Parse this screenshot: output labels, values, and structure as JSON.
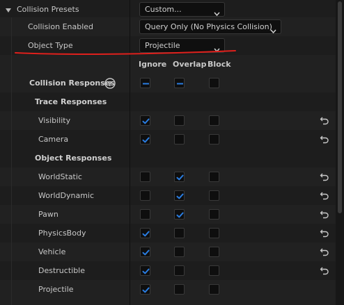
{
  "presets": {
    "label": "Collision Presets",
    "value": "Custom..."
  },
  "collision_enabled": {
    "label": "Collision Enabled",
    "value": "Query Only (No Physics Collision)"
  },
  "object_type": {
    "label": "Object Type",
    "value": "Projectile"
  },
  "columns": {
    "ignore": "Ignore",
    "overlap": "Overlap",
    "block": "Block"
  },
  "collision_responses": {
    "label": "Collision Responses",
    "help_icon": "question-circle-icon",
    "ignore": "partial",
    "overlap": "partial",
    "block": "unchecked"
  },
  "trace_header": "Trace Responses",
  "trace_rows": [
    {
      "label": "Visibility",
      "state": "ignore",
      "reset": true
    },
    {
      "label": "Camera",
      "state": "ignore",
      "reset": true
    }
  ],
  "object_header": "Object Responses",
  "object_rows": [
    {
      "label": "WorldStatic",
      "state": "overlap",
      "reset": true
    },
    {
      "label": "WorldDynamic",
      "state": "overlap",
      "reset": true
    },
    {
      "label": "Pawn",
      "state": "overlap",
      "reset": true
    },
    {
      "label": "PhysicsBody",
      "state": "ignore",
      "reset": true
    },
    {
      "label": "Vehicle",
      "state": "ignore",
      "reset": true
    },
    {
      "label": "Destructible",
      "state": "ignore",
      "reset": true
    },
    {
      "label": "Projectile",
      "state": "ignore",
      "reset": false
    }
  ],
  "colors": {
    "accent": "#2a7de1",
    "annotation": "#e0201c"
  }
}
